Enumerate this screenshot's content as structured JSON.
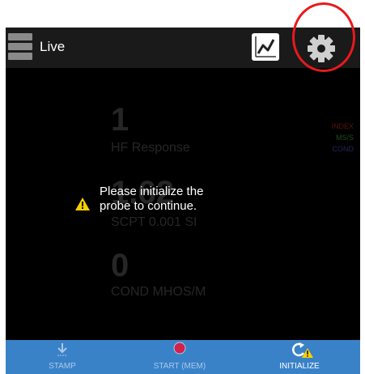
{
  "header": {
    "title": "Live"
  },
  "readings": [
    {
      "value": "1",
      "label": "HF Response"
    },
    {
      "value": "1.62",
      "label": "SCPT 0.001 SI"
    },
    {
      "value": "0",
      "label": "COND MHOS/M"
    }
  ],
  "legend": [
    {
      "label": "INDEX",
      "color": "#5a1010"
    },
    {
      "label": "MS/S",
      "color": "#1f4a1f"
    },
    {
      "label": "COND",
      "color": "#1c2a5a"
    }
  ],
  "dialog": {
    "message_line1": "Please initialize the",
    "message_line2": "probe to continue."
  },
  "bottombar": {
    "stamp_label": "STAMP",
    "start_label": "START (MEM)",
    "initialize_label": "INITIALIZE"
  },
  "colors": {
    "accent": "#3a82c8",
    "highlight": "#e8191c",
    "record": "#d4204c"
  }
}
